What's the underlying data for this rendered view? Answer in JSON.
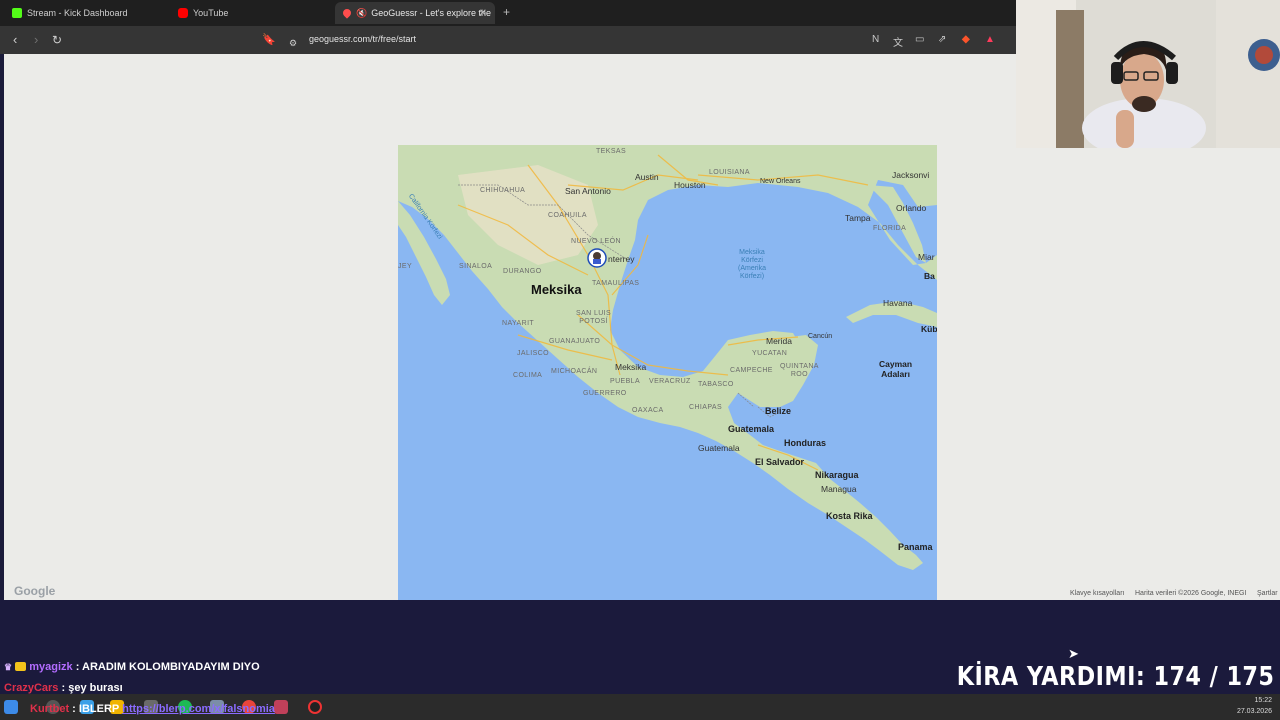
{
  "browser": {
    "tabs": [
      {
        "label": "Stream - Kick Dashboard",
        "icon": "kick-icon",
        "color": "#53fc18"
      },
      {
        "label": "YouTube",
        "icon": "youtube-icon",
        "color": "#ff0000"
      },
      {
        "label": "GeoGuessr - Let's explore the",
        "icon": "geoguessr-pin-icon",
        "color": "#ff4d4d",
        "active": true
      }
    ],
    "url": "geoguessr.com/tr/free/start"
  },
  "map": {
    "labels": {
      "teksas": "TEKSAS",
      "austin": "Austin",
      "san_antonio": "San Antonio",
      "houston": "Houston",
      "louisiana": "LOUISIANA",
      "new_orleans": "New Orleans",
      "jacksonville": "Jacksonvi",
      "orlando": "Orlando",
      "tampa": "Tampa",
      "florida": "FLORIDA",
      "miami": "Miar",
      "bahamas": "Ba",
      "chihuahua": "CHIHUAHUA",
      "coahuila": "COAHUILA",
      "nuevo_leon": "NUEVO LEÓN",
      "monterrey": "nterrey",
      "tamaulipas": "TAMAULIPAS",
      "sinaloa": "SINALOA",
      "durango": "DURANGO",
      "baja_sur": "JEY",
      "baja": "California Körfezi",
      "meksika_country": "Meksika",
      "sea": "Meksika\nKörfezi\n(Amerika\nKörfezi)",
      "havana": "Havana",
      "kuba": "Küb",
      "nayarit": "NAYARIT",
      "san_luis": "SAN LUIS\nPOTOSÍ",
      "guanajuato": "GUANAJUATO",
      "jalisco": "JALISCO",
      "colima": "COLIMA",
      "michoacan": "MICHOACÁN",
      "meksika_city": "Meksika",
      "puebla": "PUEBLA",
      "veracruz": "VERACRUZ",
      "guerrero": "GUERRERO",
      "oaxaca": "OAXACA",
      "tabasco": "TABASCO",
      "chiapas": "CHIAPAS",
      "merida": "Merida",
      "cancun": "Cancún",
      "yucatan": "YUCATAN",
      "campeche": "CAMPECHE",
      "quintana_roo": "QUINTANA\nROO",
      "cayman": "Cayman\nAdaları",
      "belize": "Belize",
      "guatemala": "Guatemala",
      "guatemala_city": "Guatemala",
      "honduras": "Honduras",
      "el_salvador": "El Salvador",
      "nikaragua": "Nikaragua",
      "managua": "Managua",
      "kosta_rika": "Kosta Rika",
      "panama": "Panama"
    },
    "google_logo": "Google",
    "footer": {
      "shortcuts": "Klavye kısayolları",
      "data": "Harita verileri ©2026 Google, INEGI",
      "terms": "Şartlar"
    }
  },
  "chat": [
    {
      "user": "myagizk",
      "user_color": "#b36cff",
      "text": ": ARADIM KOLOMBIYADAYIM DIYO"
    },
    {
      "user": "CrazyCars",
      "user_color": "#e0304a",
      "text": ": şey burası"
    }
  ],
  "overlay": {
    "kira_label": "KİRA YARDIMI:",
    "kira_value": "174 / 175"
  },
  "taskbar": {
    "overlap_user": "Kurtbet",
    "overlap_text": ": IBLERP",
    "overlap_link": "https://blerp.com/x/falsnomia",
    "time": "15:22",
    "date": "27.03.2026"
  }
}
